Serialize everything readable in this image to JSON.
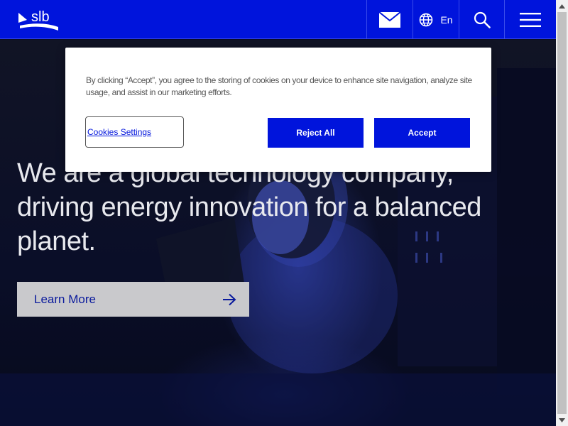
{
  "header": {
    "logo_text": "slb",
    "language_label": "En",
    "icons": [
      "mail-icon",
      "globe-icon",
      "search-icon",
      "hamburger-menu-icon"
    ]
  },
  "hero": {
    "title": "We are a global technology company, driving energy innovation for a balanced planet.",
    "cta_label": "Learn More",
    "cta_icon": "arrow-right-icon"
  },
  "cookie_banner": {
    "text": "By clicking “Accept”, you agree to the storing of cookies on your device to enhance site navigation, analyze site usage, and assist in our marketing efforts.",
    "settings_label": "Cookies Settings",
    "reject_label": "Reject All",
    "accept_label": "Accept"
  },
  "colors": {
    "brand_blue": "#0014dc",
    "hero_bg": "#0a0d24",
    "cta_bg": "#c9c9cc"
  }
}
